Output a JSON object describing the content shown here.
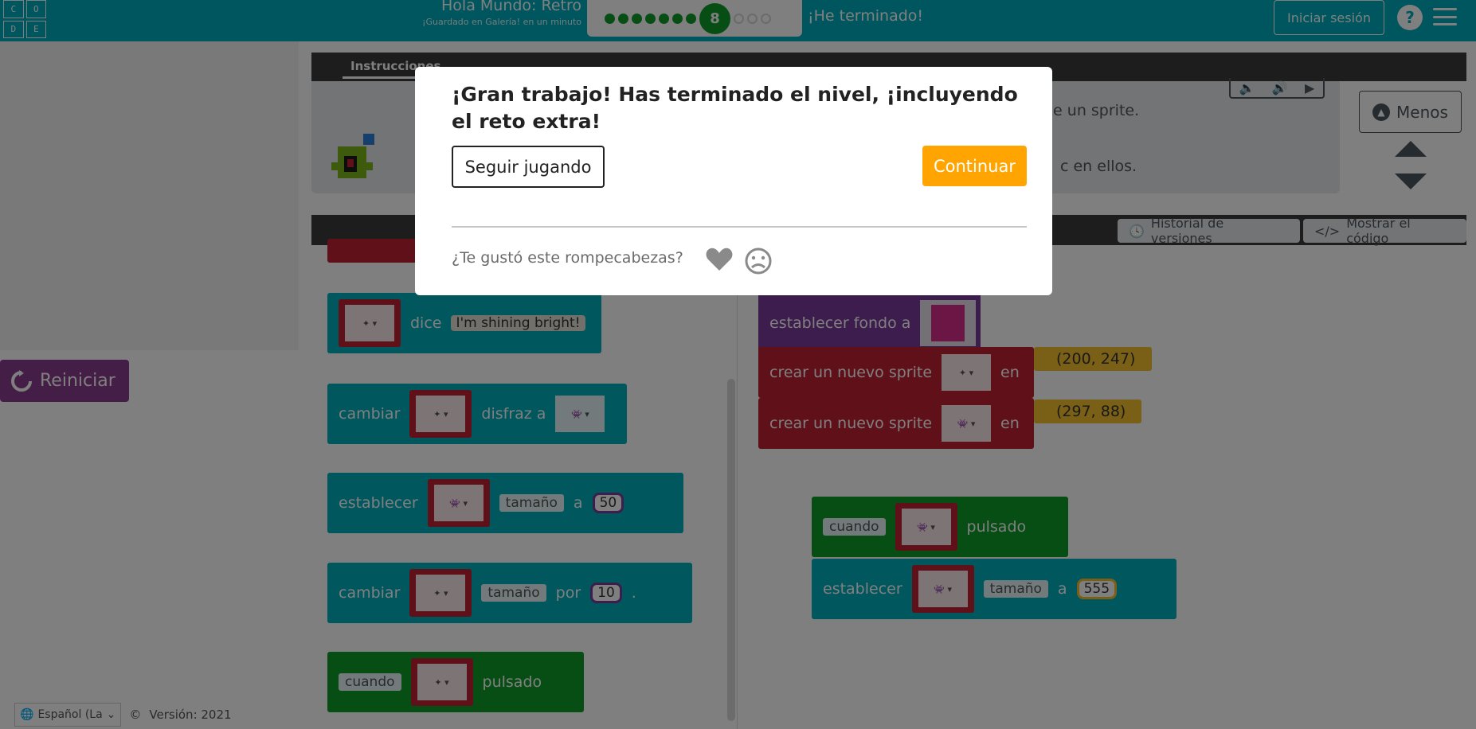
{
  "header": {
    "logo_letters": [
      "C",
      "O",
      "D",
      "E"
    ],
    "project_title": "Hola Mundo: Retro",
    "saved_status": "¡Guardado en Galería! en un minuto",
    "progress_current": "8",
    "done_text": "¡He terminado!",
    "signin_label": "Iniciar sesión",
    "help_label": "?",
    "colors": {
      "bar": "#00adbc",
      "progress_done": "#0e9c2a"
    }
  },
  "instructions": {
    "tab_label": "Instrucciones",
    "text_line1": "de un sprite.",
    "text_line2": "c en ellos.",
    "menos_label": "Menos"
  },
  "workspace": {
    "version_history_label": "Historial de versiones",
    "show_code_label": "Mostrar el código"
  },
  "left": {
    "reset_label": "Reiniciar",
    "language": "Español (La",
    "version_label": "Versión: 2021"
  },
  "toolbox": {
    "block1": {
      "verb": "dice",
      "text": "I'm shining bright!"
    },
    "block2": {
      "verb": "cambiar",
      "label": "disfraz a"
    },
    "block3": {
      "verb": "establecer",
      "prop": "tamaño",
      "op": "a",
      "value": "50"
    },
    "block4": {
      "verb": "cambiar",
      "prop": "tamaño",
      "op": "por",
      "value": "10",
      "tail": "."
    },
    "block5": {
      "event": "cuando",
      "trigger": "pulsado"
    }
  },
  "canvas": {
    "bg_block": {
      "label": "establecer fondo a"
    },
    "sprite1": {
      "label": "crear un nuevo sprite",
      "op": "en",
      "coords": "(200, 247)"
    },
    "sprite2": {
      "label": "crear un nuevo sprite",
      "op": "en",
      "coords": "(297, 88)"
    },
    "event": {
      "event": "cuando",
      "trigger": "pulsado"
    },
    "set_size": {
      "verb": "establecer",
      "prop": "tamaño",
      "op": "a",
      "value": "555"
    }
  },
  "modal": {
    "title": "¡Gran trabajo! Has terminado el nivel, ¡incluyendo el reto extra!",
    "keep_playing_label": "Seguir jugando",
    "continue_label": "Continuar",
    "rating_question": "¿Te gustó este rompecabezas?",
    "continue_color": "#ffa400"
  }
}
